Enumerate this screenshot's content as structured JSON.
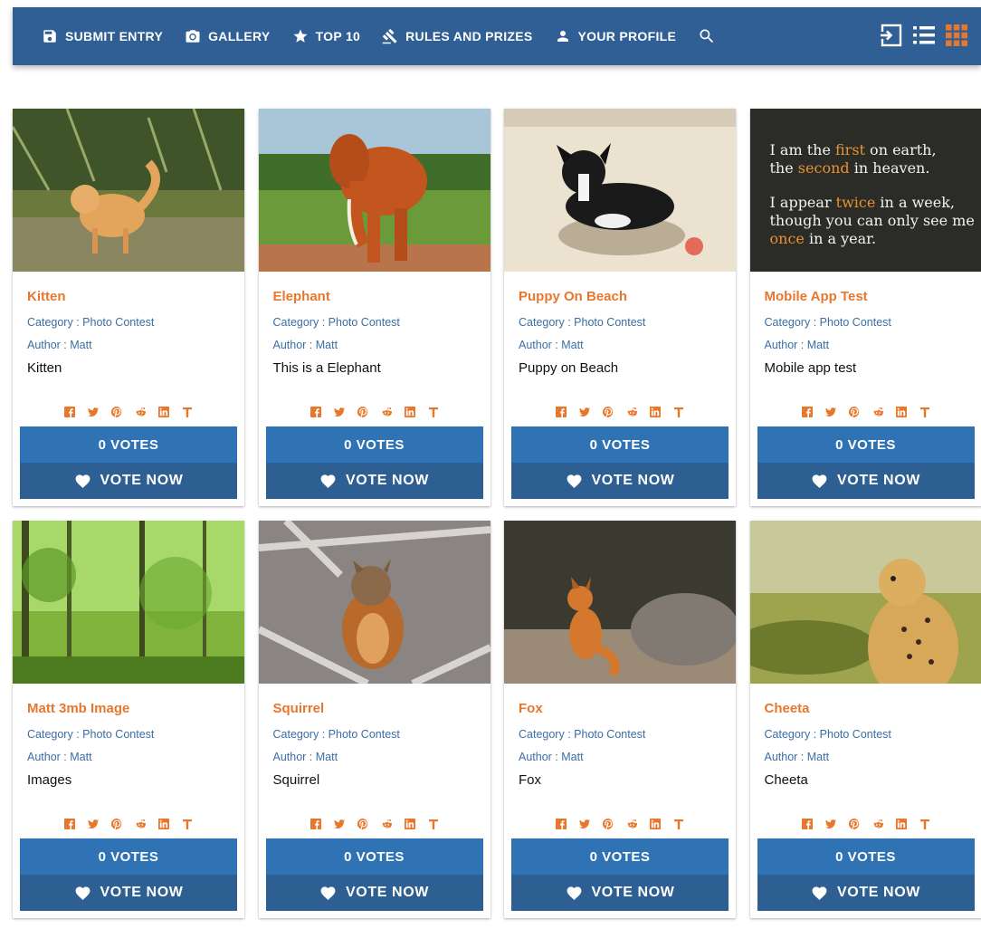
{
  "nav": {
    "items": [
      {
        "label": "SUBMIT ENTRY",
        "icon": "save-icon"
      },
      {
        "label": "GALLERY",
        "icon": "camera-icon"
      },
      {
        "label": "TOP 10",
        "icon": "star-icon"
      },
      {
        "label": "RULES AND PRIZES",
        "icon": "gavel-icon"
      },
      {
        "label": "YOUR PROFILE",
        "icon": "person-icon"
      }
    ],
    "search_icon": "search-icon",
    "right_icons": [
      "login-icon",
      "list-view-icon",
      "grid-view-icon"
    ]
  },
  "colors": {
    "nav_bg": "#2f5f94",
    "accent": "#e8772e",
    "link": "#3a6ea5",
    "votes_bg": "#2f73b4",
    "vote_now_bg": "#2d5f93"
  },
  "labels": {
    "category_prefix": "Category :",
    "author_prefix": "Author :",
    "votes_suffix": "VOTES",
    "vote_now": "VOTE NOW"
  },
  "social_icons": [
    "facebook-icon",
    "twitter-icon",
    "pinterest-icon",
    "reddit-icon",
    "linkedin-icon",
    "tumblr-icon"
  ],
  "entries": [
    {
      "title": "Kitten",
      "category": "Photo Contest",
      "author": "Matt",
      "description": "Kitten",
      "votes": "0 VOTES",
      "image": "kitten"
    },
    {
      "title": "Elephant",
      "category": "Photo Contest",
      "author": "Matt",
      "description": "This is a Elephant",
      "votes": "0 VOTES",
      "image": "elephant"
    },
    {
      "title": "Puppy On Beach",
      "category": "Photo Contest",
      "author": "Matt",
      "description": "Puppy on Beach",
      "votes": "0 VOTES",
      "image": "puppy"
    },
    {
      "title": "Mobile App Test",
      "category": "Photo Contest",
      "author": "Matt",
      "description": "Mobile app test",
      "votes": "0 VOTES",
      "image": "quote",
      "image_text": {
        "line1a": "I am the ",
        "line1b": "first",
        "line1c": " on earth,",
        "line2a": "the ",
        "line2b": "second",
        "line2c": " in heaven.",
        "line3a": "I appear ",
        "line3b": "twice",
        "line3c": " in a week,",
        "line4": "though you can only see me",
        "line5a": "once",
        "line5b": " in a year."
      }
    },
    {
      "title": "Matt 3mb Image",
      "category": "Photo Contest",
      "author": "Matt",
      "description": "Images",
      "votes": "0 VOTES",
      "image": "forest"
    },
    {
      "title": "Squirrel",
      "category": "Photo Contest",
      "author": "Matt",
      "description": "Squirrel",
      "votes": "0 VOTES",
      "image": "squirrel"
    },
    {
      "title": "Fox",
      "category": "Photo Contest",
      "author": "Matt",
      "description": "Fox",
      "votes": "0 VOTES",
      "image": "fox"
    },
    {
      "title": "Cheeta",
      "category": "Photo Contest",
      "author": "Matt",
      "description": "Cheeta",
      "votes": "0 VOTES",
      "image": "cheetah"
    }
  ]
}
